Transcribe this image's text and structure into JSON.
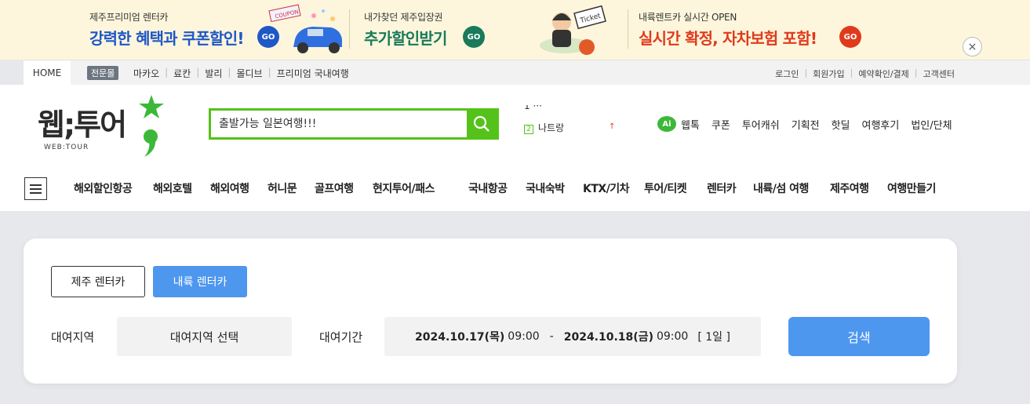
{
  "banner": {
    "promos": [
      {
        "small": "제주프리미엄 렌터카",
        "big": "강력한 혜택과 쿠폰할인!",
        "go": "GO",
        "go_color": "#1f57c7"
      },
      {
        "small": "내가찾던 제주입장권",
        "big": "추가할인받기",
        "go": "GO",
        "go_color": "#1a7a5a"
      },
      {
        "small": "내륙렌트카 실시간 OPEN",
        "big": "실시간 확정, 자차보험 포함!",
        "go": "GO",
        "go_color": "#e03a1c"
      }
    ],
    "coupon_tag": "COUPON",
    "ticket_tag": "Ticket",
    "close": "×"
  },
  "util": {
    "home": "HOME",
    "pro_badge": "전문몰",
    "left_links": [
      "마카오",
      "료칸",
      "발리",
      "몰디브",
      "프리미엄 국내여행"
    ],
    "right_links": [
      "로그인",
      "회원가입",
      "예약확인/결제",
      "고객센터"
    ]
  },
  "header": {
    "logo_text": "웹;투어",
    "logo_sub": "WEB:TOUR",
    "search_placeholder": "출발가능 일본여행!!!",
    "rank_top": "1 ···",
    "rank_num": "2",
    "rank_item": "나트랑",
    "rank_arrow": "↑",
    "ai_label": "Ai",
    "right_links": [
      "웹톡",
      "쿠폰",
      "투어캐쉬",
      "기획전",
      "핫딜",
      "여행후기",
      "법인/단체"
    ]
  },
  "nav": {
    "items": [
      "해외할인항공",
      "해외호텔",
      "해외여행",
      "허니문",
      "골프여행",
      "현지투어/패스",
      "국내항공",
      "국내숙박",
      "KTX/기차",
      "투어/티켓",
      "렌터카",
      "내륙/섬 여행",
      "제주여행",
      "여행만들기"
    ]
  },
  "panel": {
    "tab_jeju": "제주 렌터카",
    "tab_land": "내륙 렌터카",
    "region_label": "대여지역",
    "region_value": "대여지역 선택",
    "period_label": "대여기간",
    "start_date": "2024.10.17(목)",
    "start_time": "09:00",
    "dash": "-",
    "end_date": "2024.10.18(금)",
    "end_time": "09:00",
    "days": "[ 1일 ]",
    "submit": "검색"
  },
  "colors": {
    "accent_green": "#55c21b",
    "accent_blue": "#4e97ef",
    "banner_bg": "#fdf6dc"
  }
}
